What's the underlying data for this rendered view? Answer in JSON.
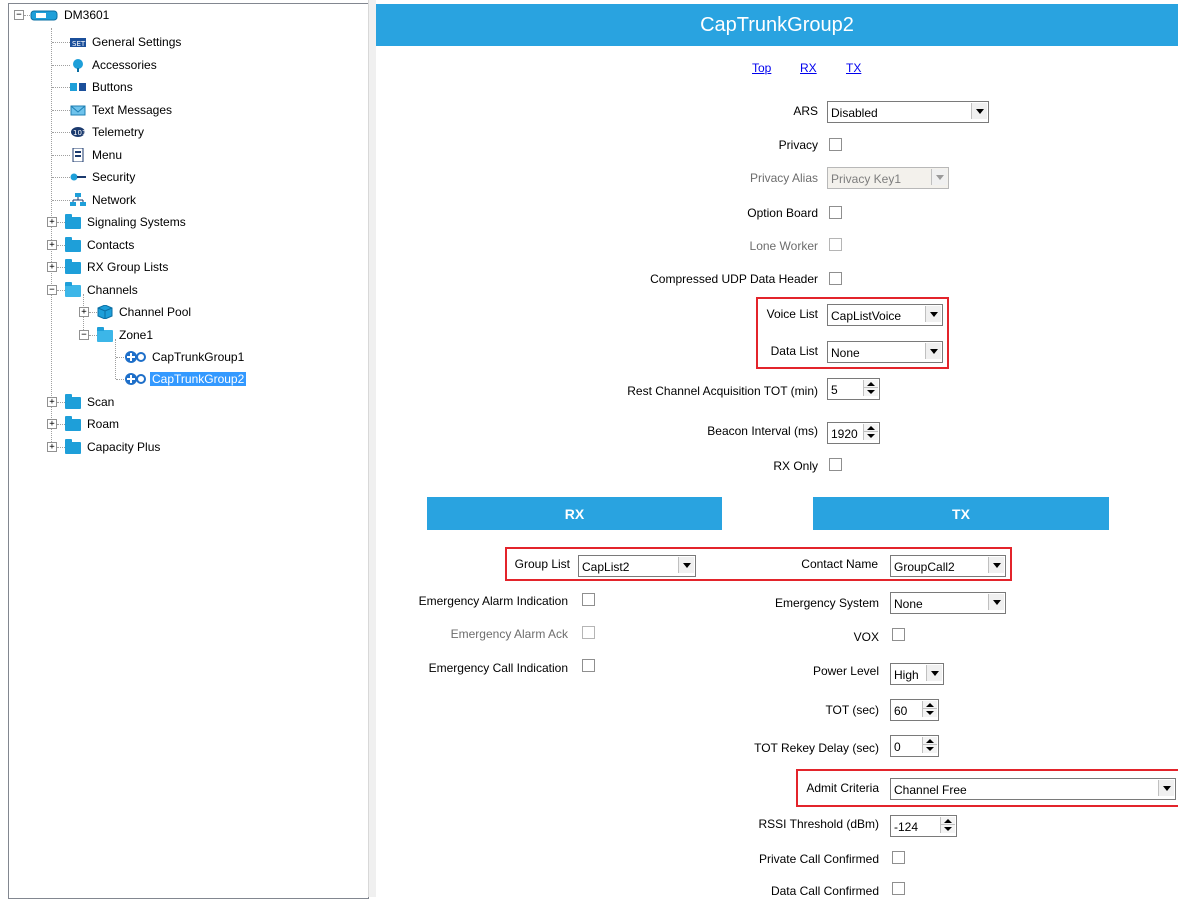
{
  "tree": {
    "root": "DM3601",
    "items": {
      "general_settings": "General Settings",
      "accessories": "Accessories",
      "buttons": "Buttons",
      "text_messages": "Text Messages",
      "telemetry": "Telemetry",
      "menu": "Menu",
      "security": "Security",
      "network": "Network",
      "signaling_systems": "Signaling Systems",
      "contacts": "Contacts",
      "rx_group_lists": "RX Group Lists",
      "channels": "Channels",
      "channel_pool": "Channel Pool",
      "zone1": "Zone1",
      "captrunkgroup1": "CapTrunkGroup1",
      "captrunkgroup2": "CapTrunkGroup2",
      "scan": "Scan",
      "roam": "Roam",
      "capacity_plus": "Capacity Plus"
    },
    "selected": "captrunkgroup2"
  },
  "panel": {
    "title": "CapTrunkGroup2",
    "nav": {
      "top": "Top",
      "rx": "RX",
      "tx": "TX"
    },
    "general": {
      "ars_label": "ARS",
      "ars_value": "Disabled",
      "privacy_label": "Privacy",
      "privacy_alias_label": "Privacy Alias",
      "privacy_alias_value": "Privacy Key1",
      "option_board_label": "Option Board",
      "lone_worker_label": "Lone Worker",
      "compressed_udp_label": "Compressed UDP Data Header",
      "voice_list_label": "Voice List",
      "voice_list_value": "CapListVoice",
      "data_list_label": "Data List",
      "data_list_value": "None",
      "rest_channel_label": "Rest Channel Acquisition TOT (min)",
      "rest_channel_value": "5",
      "beacon_label": "Beacon Interval (ms)",
      "beacon_value": "1920",
      "rx_only_label": "RX Only"
    },
    "rx": {
      "header": "RX",
      "group_list_label": "Group List",
      "group_list_value": "CapList2",
      "emergency_alarm_indication_label": "Emergency Alarm Indication",
      "emergency_alarm_ack_label": "Emergency Alarm Ack",
      "emergency_call_indication_label": "Emergency Call Indication"
    },
    "tx": {
      "header": "TX",
      "contact_name_label": "Contact Name",
      "contact_name_value": "GroupCall2",
      "emergency_system_label": "Emergency System",
      "emergency_system_value": "None",
      "vox_label": "VOX",
      "power_level_label": "Power Level",
      "power_level_value": "High",
      "tot_label": "TOT (sec)",
      "tot_value": "60",
      "tot_rekey_label": "TOT Rekey Delay (sec)",
      "tot_rekey_value": "0",
      "admit_criteria_label": "Admit Criteria",
      "admit_criteria_value": "Channel Free",
      "rssi_label": "RSSI Threshold (dBm)",
      "rssi_value": "-124",
      "private_call_label": "Private Call Confirmed",
      "data_call_label": "Data Call Confirmed"
    }
  },
  "colors": {
    "accent": "#29a3e0",
    "highlight_box": "#e3242b",
    "selection": "#3399ff"
  }
}
